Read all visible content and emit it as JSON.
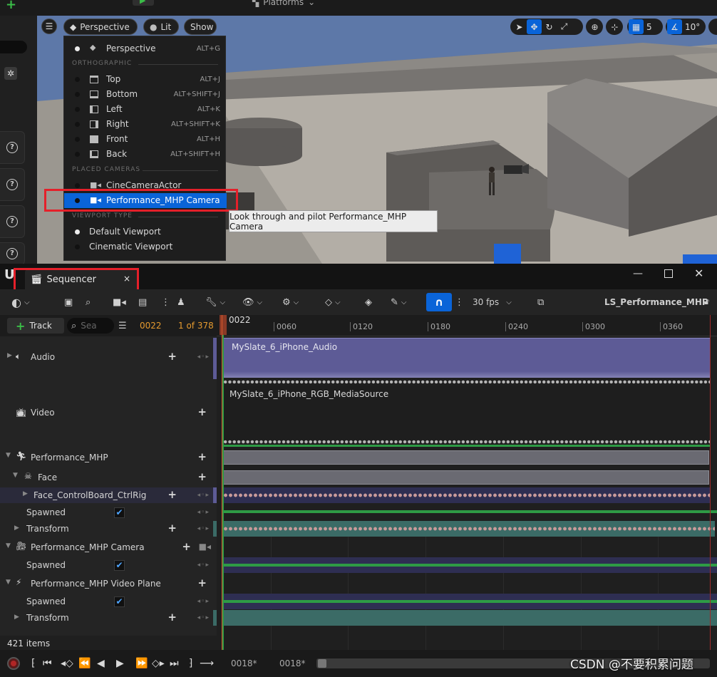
{
  "viewport": {
    "options_icon": "hamburger-icon",
    "perspective_button": "Perspective",
    "lit_button": "Lit",
    "show_button": "Show",
    "grid_snap": "5",
    "angle_snap": "10°",
    "top_label": "Platforms"
  },
  "view_menu": {
    "perspective": {
      "label": "Perspective",
      "shortcut": "ALT+G"
    },
    "ortho_header": "ORTHOGRAPHIC",
    "ortho": [
      {
        "label": "Top",
        "shortcut": "ALT+J"
      },
      {
        "label": "Bottom",
        "shortcut": "ALT+SHIFT+J"
      },
      {
        "label": "Left",
        "shortcut": "ALT+K"
      },
      {
        "label": "Right",
        "shortcut": "ALT+SHIFT+K"
      },
      {
        "label": "Front",
        "shortcut": "ALT+H"
      },
      {
        "label": "Back",
        "shortcut": "ALT+SHIFT+H"
      }
    ],
    "cameras_header": "PLACED CAMERAS",
    "cameras": [
      {
        "label": "CineCameraActor"
      },
      {
        "label": "Performance_MHP Camera"
      }
    ],
    "vptype_header": "VIEWPORT TYPE",
    "vptypes": [
      {
        "label": "Default Viewport"
      },
      {
        "label": "Cinematic Viewport"
      }
    ]
  },
  "tooltip": "Look through and pilot Performance_MHP Camera",
  "sequencer": {
    "tab_label": "Sequencer",
    "fps": "30 fps",
    "sequence_name": "LS_Performance_MHP",
    "track_button": "Track",
    "search_placeholder": "Sea",
    "current_frame": "0022",
    "frame_count": "1 of 378",
    "playhead_label": "0022",
    "ruler_ticks": [
      "0060",
      "0120",
      "0180",
      "0240",
      "0300",
      "0360"
    ],
    "tracks": {
      "audio": "Audio",
      "video": "Video",
      "performance": "Performance_MHP",
      "face": "Face",
      "ctrlrig": "Face_ControlBoard_CtrlRig",
      "spawned1": "Spawned",
      "transform1": "Transform",
      "camera": "Performance_MHP Camera",
      "spawned2": "Spawned",
      "plane": "Performance_MHP Video Plane",
      "spawned3": "Spawned",
      "transform2": "Transform"
    },
    "clips": {
      "audio": "MySlate_6_iPhone_Audio",
      "video": "MySlate_6_iPhone_RGB_MediaSource"
    },
    "items_count": "421 items",
    "range_start": "0018*",
    "range_end": "0018*"
  },
  "watermark": "CSDN @不要积累问题",
  "colors": {
    "accent_blue": "#0a64d8",
    "highlight_red": "#e5202a",
    "audio_clip": "#5d5b96",
    "timeline_green": "#2e9a45",
    "transform_teal": "#3b6b66",
    "frame_orange": "#e59a2f"
  }
}
